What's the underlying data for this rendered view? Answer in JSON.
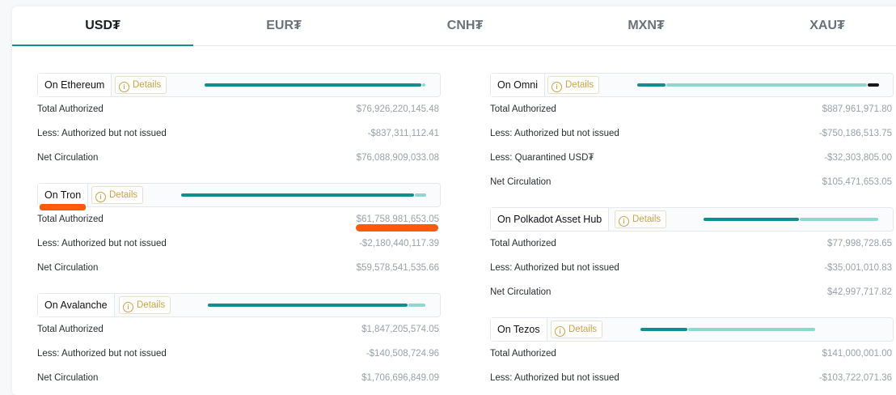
{
  "tabs": [
    "USD₮",
    "EUR₮",
    "CNH₮",
    "MXN₮",
    "XAU₮"
  ],
  "active_tab": "USD₮",
  "details_label": "Details",
  "colors": {
    "accent": "#0f8f8f",
    "light": "#8fd8d0",
    "dark": "#1a1a1a",
    "gold": "#c9a24a",
    "redact": "#ff5a0a"
  },
  "left": [
    {
      "name": "On Ethereum",
      "bar": [
        {
          "frac": 0.98,
          "color": "#0f8f8f"
        },
        {
          "frac": 0.02,
          "color": "#8fd8d0"
        }
      ],
      "rows": [
        {
          "label": "Total Authorized",
          "value": "$76,926,220,145.48"
        },
        {
          "label": "Less: Authorized but not issued",
          "value": "-$837,311,112.41"
        },
        {
          "label": "Net Circulation",
          "value": "$76,088,909,033.08"
        }
      ]
    },
    {
      "name": "On Tron",
      "bar": [
        {
          "frac": 0.95,
          "color": "#0f8f8f"
        },
        {
          "frac": 0.05,
          "color": "#8fd8d0"
        }
      ],
      "rows": [
        {
          "label": "Total Authorized",
          "value": "$61,758,981,653.05"
        },
        {
          "label": "Less: Authorized but not issued",
          "value": "-$2,180,440,117.39"
        },
        {
          "label": "Net Circulation",
          "value": "$59,578,541,535.66"
        }
      ]
    },
    {
      "name": "On Avalanche",
      "bar": [
        {
          "frac": 0.92,
          "color": "#0f8f8f"
        },
        {
          "frac": 0.08,
          "color": "#8fd8d0"
        }
      ],
      "rows": [
        {
          "label": "Total Authorized",
          "value": "$1,847,205,574.05"
        },
        {
          "label": "Less: Authorized but not issued",
          "value": "-$140,508,724.96"
        },
        {
          "label": "Net Circulation",
          "value": "$1,706,696,849.09"
        }
      ]
    }
  ],
  "right": [
    {
      "name": "On Omni",
      "bar": [
        {
          "frac": 0.12,
          "color": "#0f8f8f"
        },
        {
          "frac": 0.83,
          "color": "#8fd8d0"
        },
        {
          "frac": 0.05,
          "color": "#1a1a1a"
        }
      ],
      "rows": [
        {
          "label": "Total Authorized",
          "value": "$887,961,971.80"
        },
        {
          "label": "Less: Authorized but not issued",
          "value": "-$750,186,513.75"
        },
        {
          "label": "Less: Quarantined USD₮",
          "value": "-$32,303,805.00"
        },
        {
          "label": "Net Circulation",
          "value": "$105,471,653.05"
        }
      ]
    },
    {
      "name": "On Polkadot Asset Hub",
      "bar": [
        {
          "frac": 0.55,
          "color": "#0f8f8f"
        },
        {
          "frac": 0.45,
          "color": "#8fd8d0"
        }
      ],
      "rows": [
        {
          "label": "Total Authorized",
          "value": "$77,998,728.65"
        },
        {
          "label": "Less: Authorized but not issued",
          "value": "-$35,001,010.83"
        },
        {
          "label": "Net Circulation",
          "value": "$42,997,717.82"
        }
      ]
    },
    {
      "name": "On Tezos",
      "bar": [
        {
          "frac": 0.27,
          "color": "#0f8f8f"
        },
        {
          "frac": 0.73,
          "color": "#8fd8d0"
        }
      ],
      "rows": [
        {
          "label": "Total Authorized",
          "value": "$141,000,001.00"
        },
        {
          "label": "Less: Authorized but not issued",
          "value": "-$103,722,071.36"
        }
      ]
    }
  ]
}
